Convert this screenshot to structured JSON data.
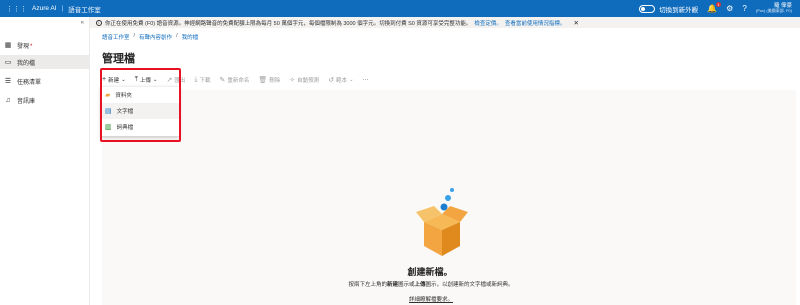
{
  "header": {
    "brand": "Azure AI",
    "app_title": "語音工作室",
    "toggle_label": "切換到新外觀",
    "notification_count": "1",
    "user_name": "羅 偉豪",
    "user_org": "(Poc) (美國東部, F0)"
  },
  "notice": {
    "icon": "info-icon",
    "text": "你正在使用免費 (F0) 語音資源。神經網路聲音的免費配額上限為每月 50 萬個字元，每個檔限制為 3000 個字元。切換到付費 S0 資源可享受完整功能。",
    "link1": "檢查定價。",
    "link2": "查看當前使用情況指標。"
  },
  "sidebar": {
    "items": [
      {
        "label": "發現",
        "icon": "grid-icon",
        "required": "*"
      },
      {
        "label": "我的檔",
        "icon": "folder-icon"
      },
      {
        "label": "任務清單",
        "icon": "list-icon"
      },
      {
        "label": "音訊庫",
        "icon": "audio-icon"
      }
    ]
  },
  "breadcrumb": [
    "語音工作室",
    "有聲內容創作",
    "我的檔"
  ],
  "page_title": "管理檔",
  "toolbar": {
    "new": "新建",
    "upload": "上傳",
    "export": "匯出",
    "download": "下載",
    "rename": "重新命名",
    "delete": "刪除",
    "predict": "自動預測",
    "version": "範本",
    "more": "···"
  },
  "new_menu": {
    "options": [
      {
        "label": "資料夾",
        "icon": "folder-icon"
      },
      {
        "label": "文字檔",
        "icon": "text-file-icon"
      },
      {
        "label": "詞典檔",
        "icon": "lexicon-file-icon"
      }
    ]
  },
  "empty_state": {
    "title": "創建新檔。",
    "desc_pre": "按兩下左上角的",
    "desc_new": "新建",
    "desc_mid": "圖示或",
    "desc_upload": "上傳",
    "desc_post": "圖示，以創建新的文字檔或新詞典。",
    "link": "詳細瞭解檔要求。"
  },
  "colors": {
    "accent": "#0f6cbd",
    "highlight": "#e81123",
    "box": "#f2a541"
  }
}
